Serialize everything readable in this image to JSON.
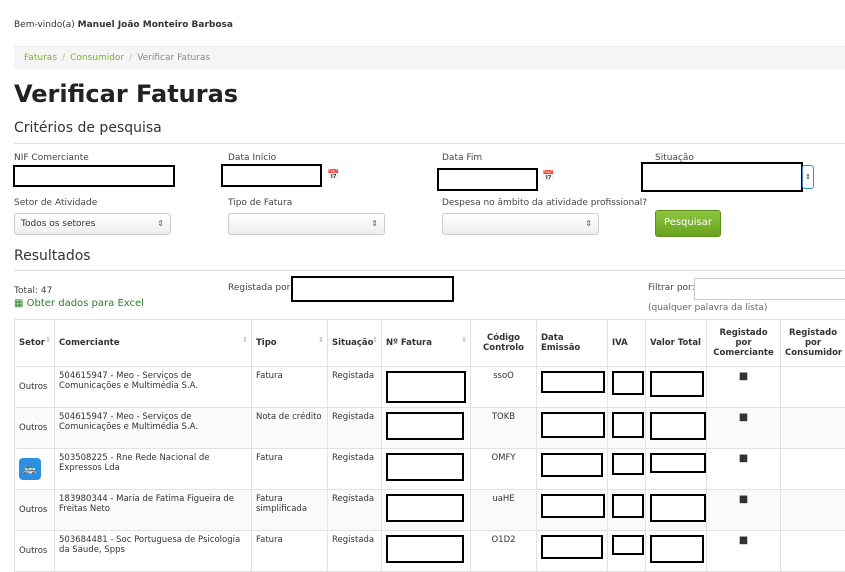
{
  "header": {
    "welcome_prefix": "Bem-vindo(a)",
    "user_name": "Manuel João Monteiro Barbosa"
  },
  "breadcrumb": {
    "items": [
      "Faturas",
      "Consumidor",
      "Verificar Faturas"
    ]
  },
  "page": {
    "title": "Verificar Faturas",
    "criteria_heading": "Critérios de pesquisa",
    "results_heading": "Resultados"
  },
  "form": {
    "nif_label": "NIF Comerciante",
    "nif_value": "",
    "data_inicio_label": "Data Início",
    "data_inicio_value": "",
    "data_fim_label": "Data Fim",
    "data_fim_value": "",
    "situacao_label": "Situação",
    "situacao_value": "",
    "setor_label": "Setor de Atividade",
    "setor_value": "Todos os setores",
    "tipo_label": "Tipo de Fatura",
    "tipo_value": "",
    "despesa_label": "Despesa no âmbito da atividade profissional?",
    "despesa_value": "",
    "search_button": "Pesquisar"
  },
  "results_bar": {
    "total": "Total: 47",
    "excel": "Obter dados para Excel",
    "registada_label": "Registada por:",
    "filter_label": "Filtrar por:",
    "filter_hint": "(qualquer palavra da lista)"
  },
  "table": {
    "headers": [
      "Setor",
      "Comerciante",
      "Tipo",
      "Situação",
      "Nº Fatura",
      "Código Controlo",
      "Data Emissão",
      "IVA",
      "Valor Total",
      "Registado por Comerciante",
      "Registado por Consumidor"
    ],
    "rows": [
      {
        "setor": "Outros",
        "comerciante": "504615947 - Meo - Serviços de Comunicações e Multimédia S.A.",
        "tipo": "Fatura",
        "situacao": "Registada",
        "codigo": "ssoO"
      },
      {
        "setor": "Outros",
        "comerciante": "504615947 - Meo - Serviços de Comunicações e Multimédia S.A.",
        "tipo": "Nota de crédito",
        "situacao": "Registada",
        "codigo": "TOKB"
      },
      {
        "setor": "",
        "comerciante": "503508225 - Rne Rede Nacional de Expressos Lda",
        "tipo": "Fatura",
        "situacao": "Registada",
        "codigo": "OMFY"
      },
      {
        "setor": "Outros",
        "comerciante": "183980344 - Maria de Fatima Figueira de Freitas Neto",
        "tipo": "Fatura simplificada",
        "situacao": "Registada",
        "codigo": "uaHE"
      },
      {
        "setor": "Outros",
        "comerciante": "503684481 - Soc Portuguesa de Psicologia da Saude, Spps",
        "tipo": "Fatura",
        "situacao": "Registada",
        "codigo": "O1D2"
      }
    ]
  },
  "icons": {
    "calendar": "calendar-icon",
    "document": "document-icon",
    "bus": "bus-icon",
    "excel": "excel-icon"
  },
  "colors": {
    "accent": "#7ab52d",
    "button": "#6aa31f",
    "bus_badge": "#2d8fe0"
  }
}
